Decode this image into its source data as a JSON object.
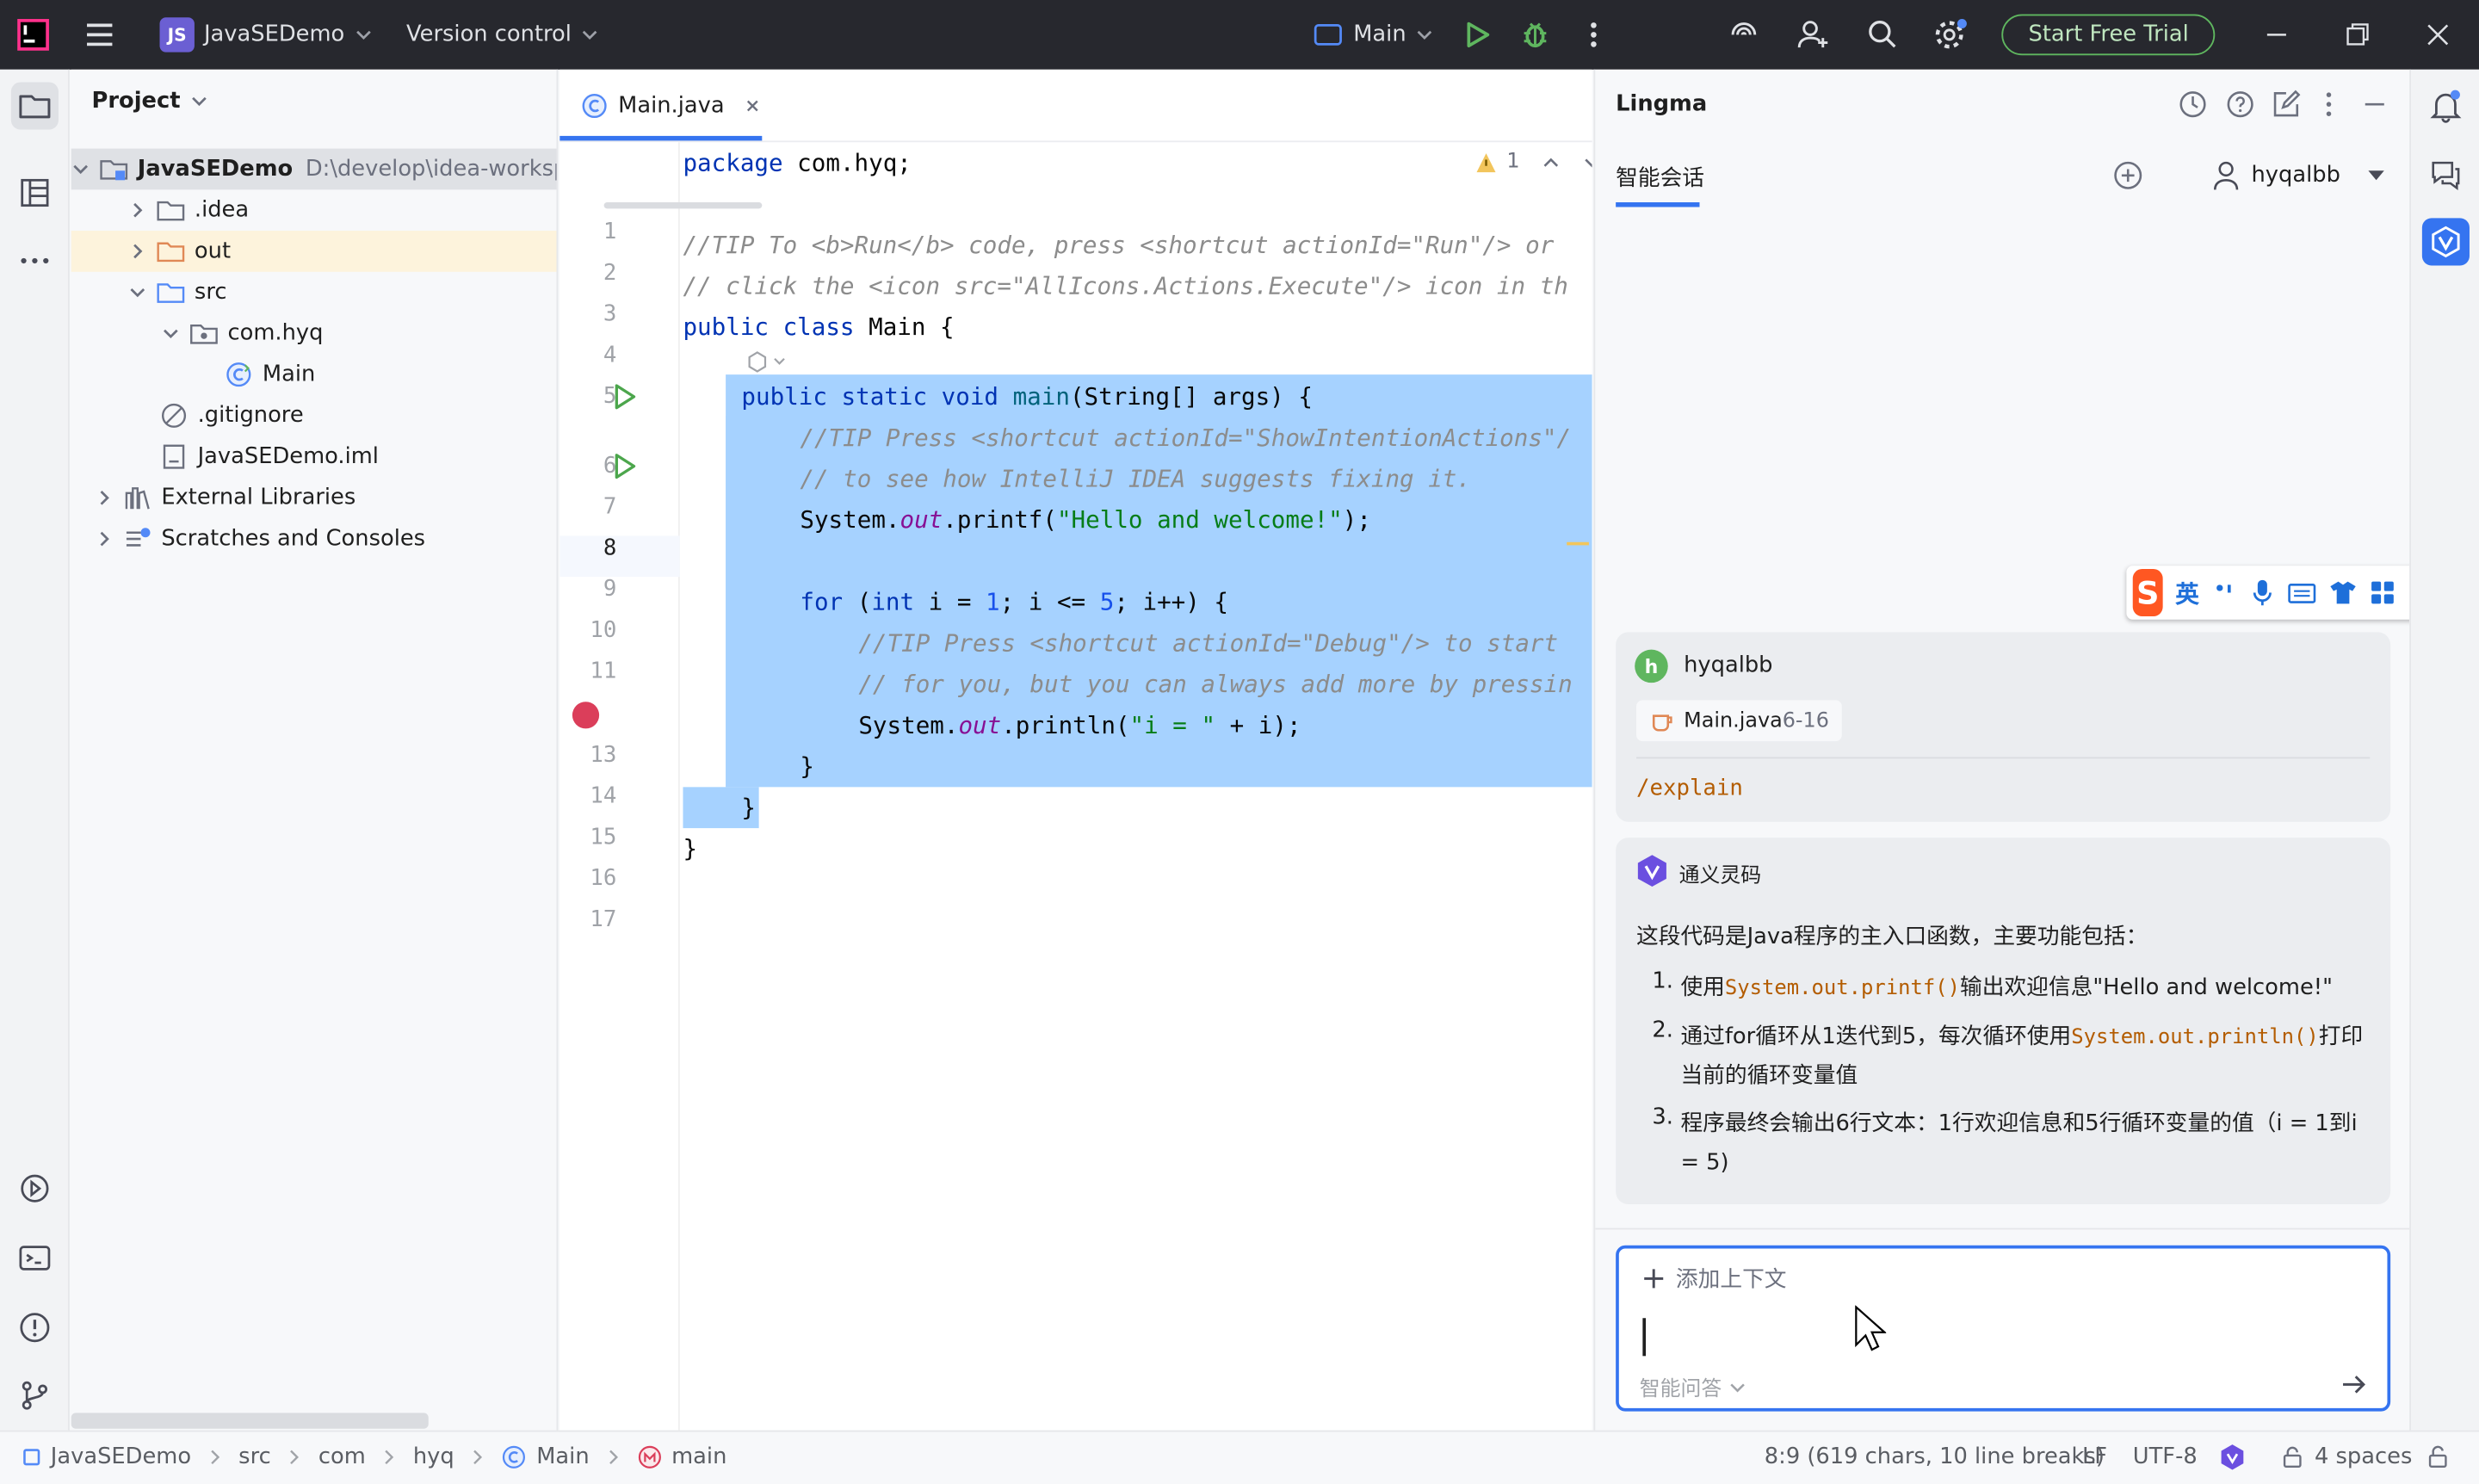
{
  "titlebar": {
    "project_badge": "JS",
    "project_name": "JavaSEDemo",
    "vcs": "Version control",
    "run_config": "Main",
    "trial_button": "Start Free Trial"
  },
  "project_panel": {
    "title": "Project",
    "tree": [
      {
        "label": "JavaSEDemo",
        "path": "D:\\develop\\idea-workspac"
      },
      {
        "label": ".idea"
      },
      {
        "label": "out"
      },
      {
        "label": "src"
      },
      {
        "label": "com.hyq"
      },
      {
        "label": "Main"
      },
      {
        "label": ".gitignore"
      },
      {
        "label": "JavaSEDemo.iml"
      },
      {
        "label": "External Libraries"
      },
      {
        "label": "Scratches and Consoles"
      }
    ]
  },
  "editor": {
    "tab": "Main.java",
    "warning_count": "1",
    "line_numbers": [
      "1",
      "2",
      "3",
      "4",
      "5",
      "6",
      "7",
      "8",
      "9",
      "10",
      "11",
      "13",
      "14",
      "15",
      "16",
      "17"
    ],
    "code": {
      "l1_kw": "package",
      "l1_rest": " com.hyq;",
      "l3": "//TIP To <b>Run</b> code, press <shortcut actionId=\"Run\"/> or",
      "l4": "// click the <icon src=\"AllIcons.Actions.Execute\"/> icon in th",
      "l5_kw": "public class",
      "l5_rest": " Main {",
      "l6_kw": "public static void",
      "l6_mth": "main",
      "l6_rest": "(String[] args) {",
      "l7": "//TIP Press <shortcut actionId=\"ShowIntentionActions\"/",
      "l8": "// to see how IntelliJ IDEA suggests fixing it.",
      "l9_a": "System.",
      "l9_fld": "out",
      "l9_b": ".printf(",
      "l9_str": "\"Hello and welcome!\"",
      "l9_c": ");",
      "l11_kw": "for",
      "l11_a": " (",
      "l11_kw2": "int",
      "l11_b": " i = ",
      "l11_n1": "1",
      "l11_c": "; i <= ",
      "l11_n2": "5",
      "l11_d": "; i++) {",
      "l12": "//TIP Press <shortcut actionId=\"Debug\"/> to start",
      "l13": "// for you, but you can always add more by pressin",
      "l14_a": "System.",
      "l14_fld": "out",
      "l14_b": ".println(",
      "l14_str": "\"i = \"",
      "l14_c": " + i);",
      "l15": "}",
      "l16": "}",
      "l17": "}"
    }
  },
  "lingma": {
    "title": "Lingma",
    "tab": "智能会话",
    "user": "hyqalbb",
    "ime_label": "英",
    "message": {
      "avatar": "h",
      "user": "hyqalbb",
      "file": "Main.java",
      "range": "6-16",
      "command": "/explain"
    },
    "reply": {
      "name": "通义灵码",
      "intro": "这段代码是Java程序的主入口函数，主要功能包括：",
      "items": [
        {
          "num": "1.",
          "pre": "使用",
          "code": "System.out.printf()",
          "post": "输出欢迎信息\"Hello and welcome!\""
        },
        {
          "num": "2.",
          "pre": "通过for循环从1迭代到5，每次循环使用",
          "code": "System.out.println()",
          "post": "打印当前的循环变量值"
        },
        {
          "num": "3.",
          "pre": "程序最终会输出6行文本：1行欢迎信息和5行循环变量的值（i = 1到i = 5)",
          "code": "",
          "post": ""
        }
      ]
    },
    "input": {
      "add_context": "添加上下文",
      "mode": "智能问答"
    }
  },
  "statusbar": {
    "breadcrumb": [
      "JavaSEDemo",
      "src",
      "com",
      "hyq",
      "Main",
      "main"
    ],
    "position": "8:9 (619 chars, 10 line breaks)",
    "line_sep": "LF",
    "encoding": "UTF-8",
    "indent": "4 spaces"
  },
  "colors": {
    "accent": "#3574f0",
    "selection": "#a6d2ff",
    "run_green": "#4ca64c",
    "breakpoint": "#db3e5a"
  }
}
